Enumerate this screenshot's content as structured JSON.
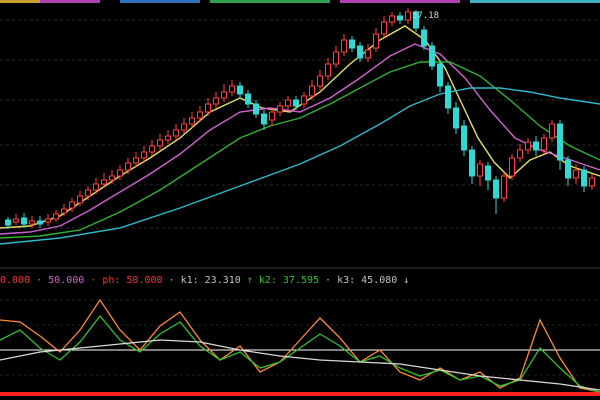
{
  "chart_data": {
    "type": "candlestick",
    "main_panel": {
      "peak_label": "57.18",
      "candles": [
        [
          8,
          220,
          225,
          217,
          229
        ],
        [
          16,
          222,
          219,
          214,
          225
        ],
        [
          24,
          218,
          224,
          213,
          228
        ],
        [
          32,
          224,
          221,
          216,
          228
        ],
        [
          40,
          221,
          224,
          216,
          228
        ],
        [
          48,
          222,
          219,
          214,
          226
        ],
        [
          56,
          219,
          214,
          210,
          222
        ],
        [
          64,
          213,
          209,
          204,
          216
        ],
        [
          72,
          208,
          202,
          198,
          212
        ],
        [
          80,
          203,
          196,
          191,
          206
        ],
        [
          88,
          196,
          190,
          186,
          200
        ],
        [
          96,
          190,
          184,
          178,
          194
        ],
        [
          104,
          184,
          180,
          173,
          188
        ],
        [
          112,
          180,
          176,
          170,
          184
        ],
        [
          120,
          176,
          170,
          165,
          180
        ],
        [
          128,
          170,
          163,
          158,
          174
        ],
        [
          136,
          163,
          158,
          152,
          167
        ],
        [
          144,
          158,
          152,
          146,
          162
        ],
        [
          152,
          152,
          146,
          140,
          156
        ],
        [
          160,
          146,
          140,
          134,
          150
        ],
        [
          168,
          140,
          136,
          130,
          144
        ],
        [
          176,
          136,
          130,
          124,
          140
        ],
        [
          184,
          130,
          124,
          118,
          134
        ],
        [
          192,
          124,
          118,
          112,
          128
        ],
        [
          200,
          118,
          112,
          106,
          122
        ],
        [
          208,
          112,
          104,
          98,
          116
        ],
        [
          216,
          104,
          98,
          92,
          108
        ],
        [
          224,
          98,
          92,
          84,
          102
        ],
        [
          232,
          92,
          86,
          80,
          96
        ],
        [
          240,
          86,
          94,
          82,
          99
        ],
        [
          248,
          94,
          104,
          90,
          108
        ],
        [
          256,
          104,
          114,
          100,
          118
        ],
        [
          264,
          114,
          124,
          110,
          130
        ],
        [
          272,
          120,
          112,
          108,
          126
        ],
        [
          280,
          112,
          106,
          102,
          116
        ],
        [
          288,
          106,
          100,
          96,
          110
        ],
        [
          296,
          100,
          106,
          96,
          110
        ],
        [
          304,
          104,
          96,
          92,
          108
        ],
        [
          312,
          96,
          86,
          80,
          100
        ],
        [
          320,
          86,
          76,
          70,
          90
        ],
        [
          328,
          76,
          64,
          58,
          80
        ],
        [
          336,
          64,
          52,
          46,
          68
        ],
        [
          344,
          52,
          40,
          34,
          56
        ],
        [
          352,
          40,
          48,
          36,
          52
        ],
        [
          360,
          46,
          58,
          42,
          62
        ],
        [
          368,
          58,
          50,
          44,
          62
        ],
        [
          376,
          48,
          34,
          28,
          52
        ],
        [
          384,
          34,
          22,
          16,
          38
        ],
        [
          392,
          22,
          16,
          12,
          26
        ],
        [
          400,
          16,
          20,
          12,
          24
        ],
        [
          408,
          20,
          12,
          8,
          24
        ],
        [
          416,
          12,
          28,
          10,
          32
        ],
        [
          424,
          30,
          46,
          26,
          50
        ],
        [
          432,
          46,
          66,
          42,
          70
        ],
        [
          440,
          64,
          86,
          60,
          92
        ],
        [
          448,
          86,
          108,
          82,
          114
        ],
        [
          456,
          108,
          128,
          102,
          134
        ],
        [
          464,
          126,
          150,
          120,
          156
        ],
        [
          472,
          150,
          176,
          146,
          184
        ],
        [
          480,
          176,
          164,
          160,
          186
        ],
        [
          488,
          166,
          180,
          162,
          190
        ],
        [
          496,
          180,
          198,
          176,
          214
        ],
        [
          504,
          198,
          176,
          172,
          202
        ],
        [
          512,
          176,
          158,
          154,
          180
        ],
        [
          520,
          158,
          150,
          144,
          162
        ],
        [
          528,
          150,
          142,
          138,
          154
        ],
        [
          536,
          142,
          150,
          136,
          156
        ],
        [
          544,
          150,
          138,
          134,
          154
        ],
        [
          552,
          138,
          124,
          120,
          142
        ],
        [
          560,
          124,
          160,
          120,
          170
        ],
        [
          568,
          160,
          178,
          156,
          186
        ],
        [
          576,
          178,
          170,
          164,
          184
        ],
        [
          584,
          170,
          186,
          166,
          192
        ],
        [
          592,
          186,
          178,
          174,
          190
        ]
      ],
      "moving_averages": [
        {
          "color": "#e8e060",
          "points": [
            [
              0,
              228
            ],
            [
              30,
              226
            ],
            [
              60,
              216
            ],
            [
              90,
              196
            ],
            [
              120,
              176
            ],
            [
              150,
              158
            ],
            [
              180,
              138
            ],
            [
              210,
              112
            ],
            [
              240,
              98
            ],
            [
              262,
              108
            ],
            [
              290,
              112
            ],
            [
              320,
              92
            ],
            [
              350,
              64
            ],
            [
              380,
              40
            ],
            [
              405,
              26
            ],
            [
              425,
              40
            ],
            [
              445,
              68
            ],
            [
              462,
              104
            ],
            [
              478,
              138
            ],
            [
              494,
              162
            ],
            [
              510,
              178
            ],
            [
              530,
              160
            ],
            [
              550,
              152
            ],
            [
              570,
              166
            ],
            [
              600,
              176
            ]
          ]
        },
        {
          "color": "#d060d0",
          "points": [
            [
              0,
              234
            ],
            [
              30,
              232
            ],
            [
              60,
              226
            ],
            [
              90,
              210
            ],
            [
              120,
              192
            ],
            [
              150,
              174
            ],
            [
              180,
              154
            ],
            [
              210,
              130
            ],
            [
              240,
              112
            ],
            [
              270,
              108
            ],
            [
              300,
              112
            ],
            [
              330,
              98
            ],
            [
              360,
              78
            ],
            [
              390,
              56
            ],
            [
              415,
              44
            ],
            [
              440,
              54
            ],
            [
              465,
              78
            ],
            [
              490,
              110
            ],
            [
              515,
              138
            ],
            [
              540,
              150
            ],
            [
              565,
              158
            ],
            [
              600,
              170
            ]
          ]
        },
        {
          "color": "#30b030",
          "points": [
            [
              0,
              238
            ],
            [
              40,
              236
            ],
            [
              80,
              230
            ],
            [
              120,
              212
            ],
            [
              160,
              190
            ],
            [
              200,
              164
            ],
            [
              240,
              138
            ],
            [
              270,
              126
            ],
            [
              300,
              118
            ],
            [
              330,
              104
            ],
            [
              360,
              88
            ],
            [
              390,
              72
            ],
            [
              420,
              62
            ],
            [
              450,
              62
            ],
            [
              480,
              76
            ],
            [
              510,
              100
            ],
            [
              540,
              126
            ],
            [
              570,
              146
            ],
            [
              600,
              160
            ]
          ]
        },
        {
          "color": "#30b8c8",
          "points": [
            [
              0,
              244
            ],
            [
              60,
              238
            ],
            [
              120,
              228
            ],
            [
              180,
              208
            ],
            [
              240,
              186
            ],
            [
              300,
              164
            ],
            [
              340,
              146
            ],
            [
              380,
              124
            ],
            [
              410,
              106
            ],
            [
              440,
              94
            ],
            [
              470,
              88
            ],
            [
              500,
              88
            ],
            [
              530,
              92
            ],
            [
              560,
              98
            ],
            [
              600,
              104
            ]
          ]
        }
      ]
    },
    "indicator_panel": {
      "legend": [
        {
          "text": "0.000",
          "color": "#ff3030"
        },
        {
          "text": "· 50.000",
          "color": "#d060d0"
        },
        {
          "text": "· ph: 50.000",
          "color": "#ff3030"
        },
        {
          "text": "· k1: 23.310",
          "color": "#c0c0c0"
        },
        {
          "text": "↑ k2: 37.595",
          "color": "#30c030"
        },
        {
          "text": "· k3: 45.080",
          "color": "#c0c0c0"
        },
        {
          "text": "↓",
          "color": "#c0c0c0"
        }
      ],
      "lines": [
        {
          "color": "#ff8a30",
          "points": [
            [
              0,
              320
            ],
            [
              20,
              322
            ],
            [
              40,
              336
            ],
            [
              60,
              352
            ],
            [
              80,
              330
            ],
            [
              100,
              300
            ],
            [
              120,
              330
            ],
            [
              140,
              350
            ],
            [
              160,
              326
            ],
            [
              180,
              312
            ],
            [
              200,
              340
            ],
            [
              220,
              360
            ],
            [
              240,
              346
            ],
            [
              260,
              372
            ],
            [
              280,
              362
            ],
            [
              300,
              340
            ],
            [
              320,
              318
            ],
            [
              340,
              338
            ],
            [
              360,
              362
            ],
            [
              380,
              350
            ],
            [
              400,
              372
            ],
            [
              420,
              380
            ],
            [
              440,
              368
            ],
            [
              460,
              380
            ],
            [
              480,
              372
            ],
            [
              500,
              388
            ],
            [
              520,
              378
            ],
            [
              540,
              320
            ],
            [
              560,
              358
            ],
            [
              580,
              388
            ],
            [
              600,
              392
            ]
          ]
        },
        {
          "color": "#30c030",
          "points": [
            [
              0,
              340
            ],
            [
              20,
              330
            ],
            [
              40,
              348
            ],
            [
              60,
              360
            ],
            [
              80,
              342
            ],
            [
              100,
              316
            ],
            [
              120,
              340
            ],
            [
              140,
              352
            ],
            [
              160,
              334
            ],
            [
              180,
              322
            ],
            [
              200,
              346
            ],
            [
              220,
              360
            ],
            [
              240,
              352
            ],
            [
              260,
              368
            ],
            [
              280,
              362
            ],
            [
              300,
              348
            ],
            [
              320,
              334
            ],
            [
              340,
              346
            ],
            [
              360,
              362
            ],
            [
              380,
              356
            ],
            [
              400,
              368
            ],
            [
              420,
              376
            ],
            [
              440,
              370
            ],
            [
              460,
              380
            ],
            [
              480,
              376
            ],
            [
              500,
              386
            ],
            [
              520,
              380
            ],
            [
              540,
              348
            ],
            [
              560,
              368
            ],
            [
              580,
              386
            ],
            [
              600,
              392
            ]
          ]
        },
        {
          "color": "#d8d8d8",
          "points": [
            [
              0,
              360
            ],
            [
              40,
              352
            ],
            [
              80,
              348
            ],
            [
              120,
              344
            ],
            [
              160,
              340
            ],
            [
              200,
              342
            ],
            [
              240,
              350
            ],
            [
              280,
              356
            ],
            [
              320,
              360
            ],
            [
              360,
              362
            ],
            [
              400,
              364
            ],
            [
              440,
              370
            ],
            [
              480,
              376
            ],
            [
              520,
              380
            ],
            [
              560,
              384
            ],
            [
              600,
              390
            ]
          ]
        }
      ],
      "levels": [
        {
          "value_y": 350,
          "color": "#ffffff"
        },
        {
          "value_y": 394,
          "color": "#ff2020"
        }
      ]
    }
  }
}
